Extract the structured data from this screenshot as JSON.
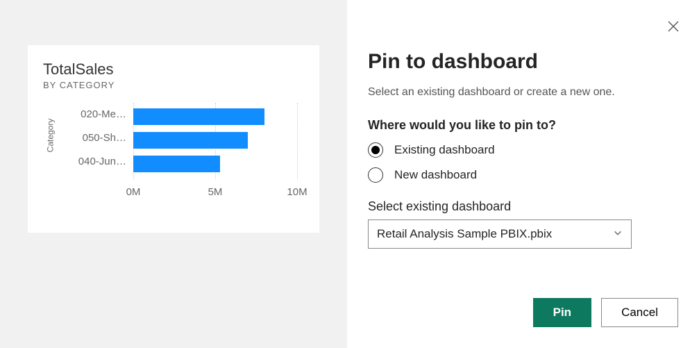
{
  "preview": {
    "title": "TotalSales",
    "subtitle": "BY CATEGORY",
    "y_axis_label": "Category"
  },
  "chart_data": {
    "type": "bar",
    "orientation": "horizontal",
    "categories": [
      "020-Me…",
      "050-Sh…",
      "040-Jun…"
    ],
    "values": [
      8,
      7,
      5.3
    ],
    "x_ticks": [
      {
        "label": "0M",
        "value": 0
      },
      {
        "label": "5M",
        "value": 5
      },
      {
        "label": "10M",
        "value": 10
      }
    ],
    "xlim": [
      0,
      10
    ],
    "xlabel": "",
    "ylabel": "Category",
    "title": "TotalSales",
    "bar_color": "#118dff"
  },
  "dialog": {
    "title": "Pin to dashboard",
    "subtitle": "Select an existing dashboard or create a new one.",
    "question": "Where would you like to pin to?",
    "options": {
      "existing": "Existing dashboard",
      "new": "New dashboard"
    },
    "selected_option": "existing",
    "select_label": "Select existing dashboard",
    "select_value": "Retail Analysis Sample PBIX.pbix",
    "buttons": {
      "pin": "Pin",
      "cancel": "Cancel"
    }
  }
}
